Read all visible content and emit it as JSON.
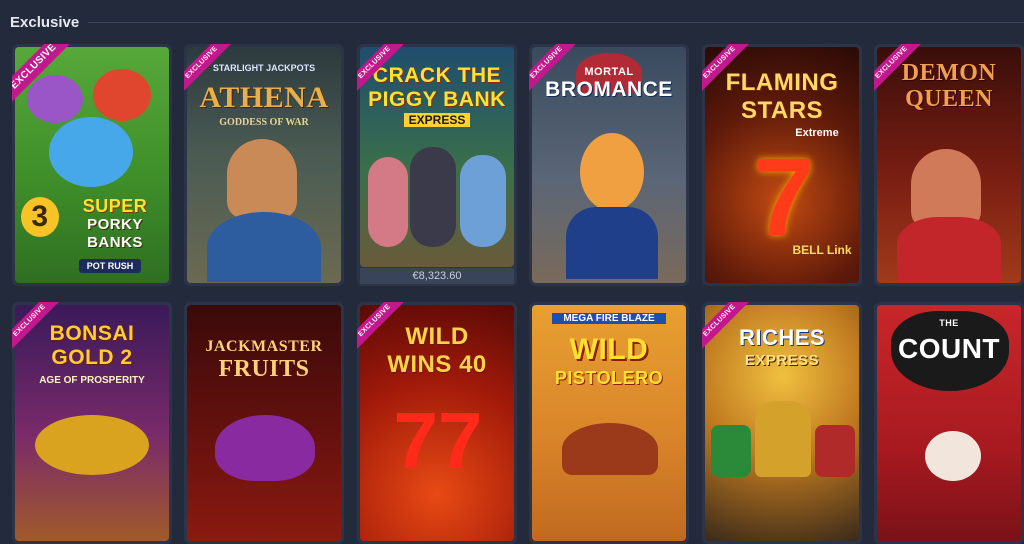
{
  "section": {
    "title": "Exclusive"
  },
  "ribbon_label": "EXCLUSIVE",
  "games": [
    {
      "title_lines": [
        "3",
        "SUPER",
        "PORKY",
        "BANKS"
      ],
      "sub": "POT RUSH",
      "exclusive": true
    },
    {
      "brand": "STARLIGHT JACKPOTS",
      "title": "ATHENA",
      "sub": "GODDESS OF WAR",
      "exclusive": true
    },
    {
      "title_lines": [
        "CRACK THE",
        "PIGGY BANK"
      ],
      "sub": "EXPRESS",
      "exclusive": true,
      "jackpot": "€8,323.60"
    },
    {
      "title_lines": [
        "MORTAL",
        "BROMANCE"
      ],
      "exclusive": true
    },
    {
      "title_lines": [
        "FLAMING",
        "STARS"
      ],
      "sub": "Extreme",
      "badge": "BELL Link",
      "exclusive": true
    },
    {
      "title_lines": [
        "DEMON",
        "QUEEN"
      ],
      "exclusive": true
    },
    {
      "title_lines": [
        "BONSAI",
        "GOLD 2"
      ],
      "sub": "AGE OF PROSPERITY",
      "exclusive": true
    },
    {
      "title_lines": [
        "JACKMASTER",
        "FRUITS"
      ],
      "exclusive": false
    },
    {
      "title_lines": [
        "WILD",
        "WINS 40"
      ],
      "exclusive": true
    },
    {
      "brand": "MEGA FIRE BLAZE",
      "title_lines": [
        "WILD",
        "PISTOLERO"
      ],
      "exclusive": false
    },
    {
      "title_lines": [
        "RICHES",
        "EXPRESS"
      ],
      "exclusive": true
    },
    {
      "title_lines": [
        "THE",
        "COUNT"
      ],
      "exclusive": false
    }
  ],
  "colors": {
    "background": "#222a3c",
    "tile_border": "#2c3548",
    "ribbon": "#c2188d"
  }
}
